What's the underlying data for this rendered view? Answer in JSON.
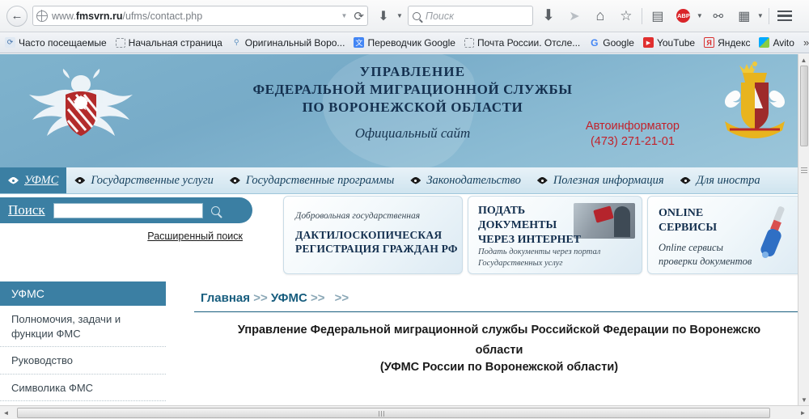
{
  "browser": {
    "back_label": "←",
    "url_prefix": "www.",
    "url_domain": "fmsvrn.ru",
    "url_path": "/ufms/contact.php",
    "url_dropdown": "▼",
    "reload_label": "⟳",
    "download_label": "⬇",
    "download_caret": "▼",
    "search_placeholder": "Поиск",
    "toolbar_download": "⬇",
    "toolbar_send": "➤",
    "toolbar_home": "⌂",
    "toolbar_star": "☆",
    "toolbar_clipboard": "▤",
    "abp_label": "ABP",
    "abp_caret": "▼",
    "toolbar_pocket": "⚯",
    "toolbar_reader": "▦",
    "toolbar_reader_caret": "▼"
  },
  "bookmarks": {
    "items": [
      {
        "label": "Часто посещаемые",
        "icon": "history-icon"
      },
      {
        "label": "Начальная страница",
        "icon": "dashed-page-icon"
      },
      {
        "label": "Оригинальный Воро...",
        "icon": "key-icon"
      },
      {
        "label": "Переводчик Google",
        "icon": "translate-icon"
      },
      {
        "label": "Почта России. Отсле...",
        "icon": "dashed-page-icon"
      },
      {
        "label": "Google",
        "icon": "google-icon"
      },
      {
        "label": "YouTube",
        "icon": "youtube-icon"
      },
      {
        "label": "Яндекс",
        "icon": "yandex-icon"
      },
      {
        "label": "Avito",
        "icon": "avito-icon"
      }
    ],
    "overflow_label": "»"
  },
  "site_header": {
    "line1": "УПРАВЛЕНИЕ",
    "line2": "ФЕДЕРАЛЬНОЙ МИГРАЦИОННОЙ СЛУЖБЫ",
    "line3": "ПО ВОРОНЕЖСКОЙ ОБЛАСТИ",
    "official": "Официальный сайт",
    "autoinfo_label": "Автоинформатор",
    "autoinfo_phone": "(473) 271-21-01",
    "autoinfo_color": "#c2222b",
    "bg_color": "#7fb3cd"
  },
  "mainnav": {
    "items": [
      {
        "label": "УФМС",
        "active": true
      },
      {
        "label": "Государственные услуги",
        "active": false
      },
      {
        "label": "Государственные программы",
        "active": false
      },
      {
        "label": "Законодательство",
        "active": false
      },
      {
        "label": "Полезная информация",
        "active": false
      },
      {
        "label": "Для иностра",
        "active": false
      }
    ],
    "active_bg": "#3b7fa3"
  },
  "search_panel": {
    "label": "Поиск",
    "input_value": "",
    "advanced_label": "Расширенный поиск"
  },
  "banners": [
    {
      "subtitle": "Добровольная государственная",
      "title_line1": "ДАКТИЛОСКОПИЧЕСКАЯ",
      "title_line2": "РЕГИСТРАЦИЯ ГРАЖДАН РФ"
    },
    {
      "title": "ПОДАТЬ\nДОКУМЕНТЫ\nЧЕРЕЗ ИНТЕРНЕТ",
      "subtitle": "Подать документы через портал\nГосударственных услуг"
    },
    {
      "title": "ONLINE\nСЕРВИСЫ",
      "subtitle": "Online сервисы\nпроверки документов"
    }
  ],
  "sidebar": {
    "header": "УФМС",
    "items": [
      {
        "label": "Полномочия, задачи и функции ФМС"
      },
      {
        "label": "Руководство"
      },
      {
        "label": "Символика ФМС"
      }
    ],
    "accent_color": "#3b7fa3"
  },
  "breadcrumb": {
    "home": "Главная",
    "sep1": ">>",
    "section": "УФМС",
    "sep2": ">>",
    "sep3": ">>"
  },
  "main": {
    "title_line1": "Управление Федеральной миграционной службы Российской Федерации по Воронежско",
    "title_line2": "области",
    "subtitle": "(УФМС России по Воронежской области)"
  },
  "scrollbars": {
    "v_up": "▲",
    "v_down": "▼",
    "h_left": "◄",
    "h_right": "►"
  }
}
